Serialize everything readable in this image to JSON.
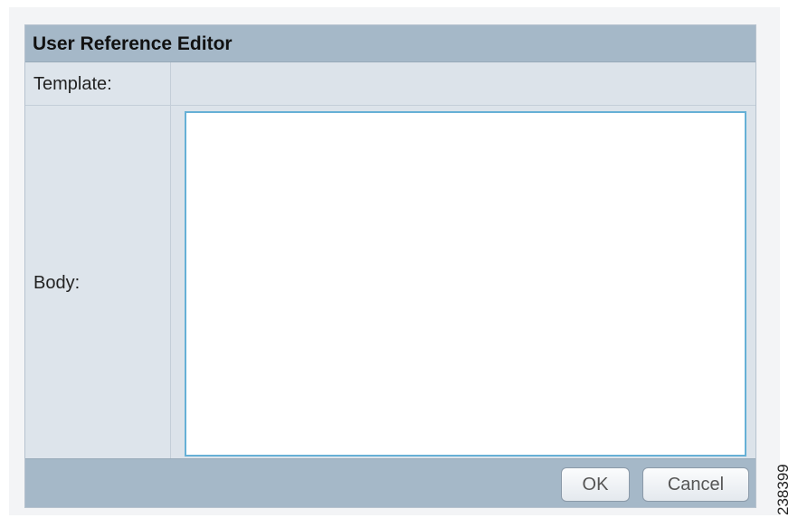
{
  "dialog": {
    "title": "User Reference Editor",
    "template_label": "Template:",
    "template_value": "",
    "body_label": "Body:",
    "body_value": ""
  },
  "buttons": {
    "ok_label": "OK",
    "cancel_label": "Cancel"
  },
  "figure_number": "238399"
}
